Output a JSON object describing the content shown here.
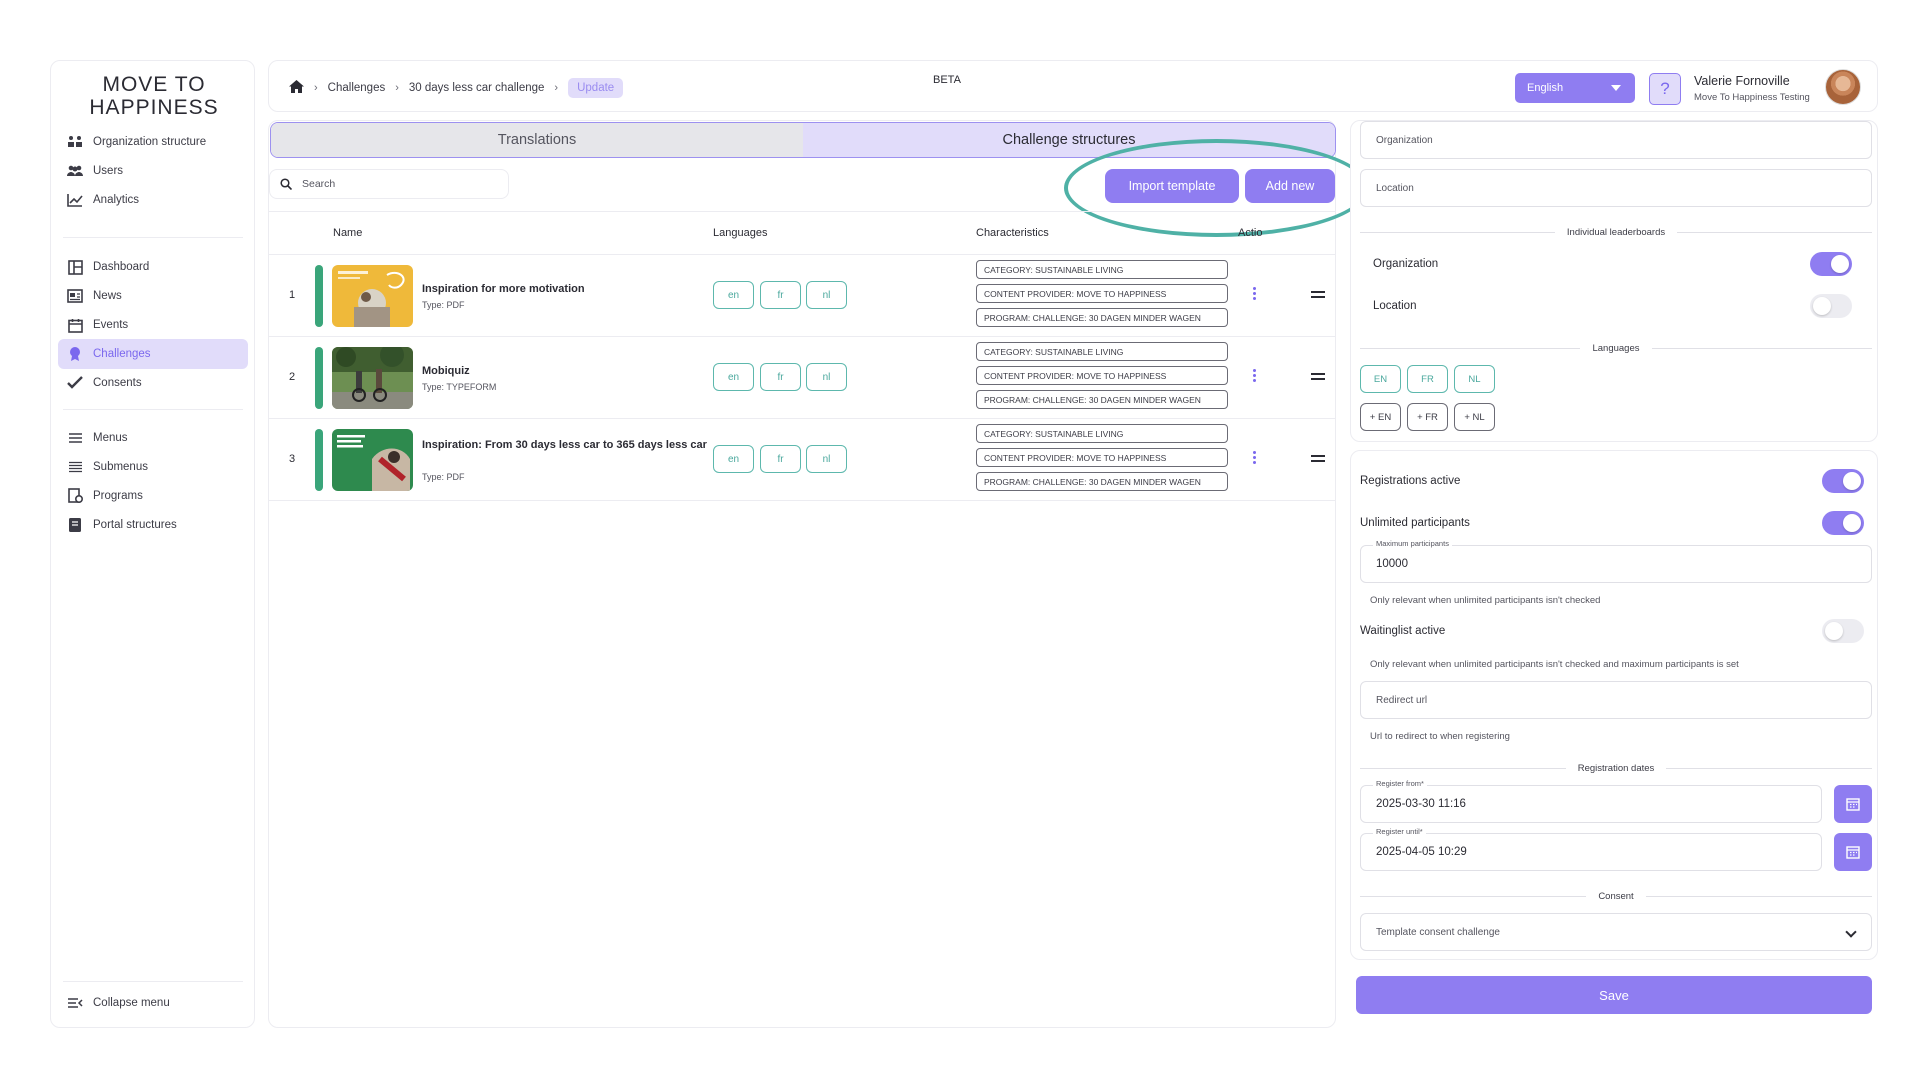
{
  "logo": {
    "line1": "MOVE TO",
    "line2": "HAPPINESS"
  },
  "sidebar": {
    "items": [
      {
        "label": "Organization structure",
        "icon": "org-structure-icon"
      },
      {
        "label": "Users",
        "icon": "users-icon"
      },
      {
        "label": "Analytics",
        "icon": "analytics-icon"
      },
      {
        "label": "Dashboard",
        "icon": "dashboard-icon"
      },
      {
        "label": "News",
        "icon": "news-icon"
      },
      {
        "label": "Events",
        "icon": "calendar-icon"
      },
      {
        "label": "Challenges",
        "icon": "badge-icon",
        "active": true
      },
      {
        "label": "Consents",
        "icon": "check-icon"
      },
      {
        "label": "Menus",
        "icon": "menu-icon"
      },
      {
        "label": "Submenus",
        "icon": "list-icon"
      },
      {
        "label": "Programs",
        "icon": "programs-icon"
      },
      {
        "label": "Portal structures",
        "icon": "book-icon"
      }
    ],
    "collapse_label": "Collapse menu"
  },
  "breadcrumb": {
    "home_icon": "home-icon",
    "items": [
      "Challenges",
      "30 days less car challenge"
    ],
    "current": "Update",
    "beta": "BETA"
  },
  "header": {
    "language": "English",
    "help": "?",
    "user_name": "Valerie Fornoville",
    "user_org": "Move To Happiness Testing"
  },
  "tabs": {
    "translations": "Translations",
    "structures": "Challenge structures"
  },
  "toolbar": {
    "search_placeholder": "Search",
    "import_label": "Import template",
    "add_label": "Add new"
  },
  "table": {
    "headers": {
      "name": "Name",
      "languages": "Languages",
      "characteristics": "Characteristics",
      "actions": "Actio"
    },
    "rows": [
      {
        "num": "1",
        "title": "Inspiration for more motivation",
        "type": "Type: PDF",
        "langs": [
          "en",
          "fr",
          "nl"
        ],
        "chars": [
          "CATEGORY: SUSTAINABLE LIVING",
          "CONTENT PROVIDER: MOVE TO HAPPINESS",
          "PROGRAM: CHALLENGE: 30 DAGEN MINDER WAGEN"
        ]
      },
      {
        "num": "2",
        "title": "Mobiquiz",
        "type": "Type: TYPEFORM",
        "langs": [
          "en",
          "fr",
          "nl"
        ],
        "chars": [
          "CATEGORY: SUSTAINABLE LIVING",
          "CONTENT PROVIDER: MOVE TO HAPPINESS",
          "PROGRAM: CHALLENGE: 30 DAGEN MINDER WAGEN"
        ]
      },
      {
        "num": "3",
        "title": "Inspiration: From 30 days less car to 365 days less car",
        "type": "Type: PDF",
        "langs": [
          "en",
          "fr",
          "nl"
        ],
        "chars": [
          "CATEGORY: SUSTAINABLE LIVING",
          "CONTENT PROVIDER: MOVE TO HAPPINESS",
          "PROGRAM: CHALLENGE: 30 DAGEN MINDER WAGEN"
        ]
      }
    ]
  },
  "settings": {
    "organization_field": "Organization",
    "location_field": "Location",
    "leaderboards_title": "Individual leaderboards",
    "lb_organization": {
      "label": "Organization",
      "on": true
    },
    "lb_location": {
      "label": "Location",
      "on": false
    },
    "languages_title": "Languages",
    "languages": [
      "EN",
      "FR",
      "NL"
    ],
    "add_languages": [
      "+ EN",
      "+ FR",
      "+ NL"
    ],
    "registrations_active": {
      "label": "Registrations active",
      "on": true
    },
    "unlimited_participants": {
      "label": "Unlimited participants",
      "on": true
    },
    "max_participants": {
      "label": "Maximum participants",
      "value": "10000",
      "hint": "Only relevant when unlimited participants isn't checked"
    },
    "waitinglist_active": {
      "label": "Waitinglist active",
      "on": false,
      "hint": "Only relevant when unlimited participants isn't checked and maximum participants is set"
    },
    "redirect_url": {
      "placeholder": "Redirect url",
      "hint": "Url to redirect to when registering"
    },
    "registration_dates_title": "Registration dates",
    "register_from": {
      "label": "Register from*",
      "value": "2025-03-30 11:16"
    },
    "register_until": {
      "label": "Register until*",
      "value": "2025-04-05 10:29"
    },
    "consent_title": "Consent",
    "consent_value": "Template consent challenge",
    "save_label": "Save"
  },
  "colors": {
    "accent": "#8f7df1",
    "accent_light": "#e1dcfa",
    "teal": "#4fb1a6",
    "green_bar": "#3aa57a"
  }
}
